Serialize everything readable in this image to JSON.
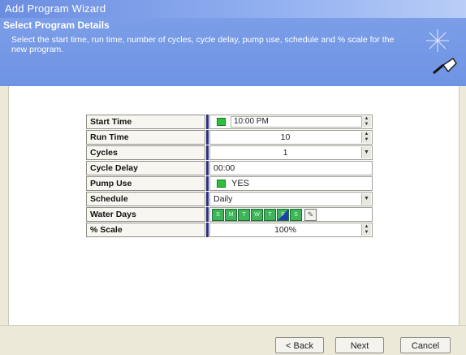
{
  "window": {
    "title": "Add Program Wizard"
  },
  "header": {
    "title": "Select Program Details",
    "description": "Select the start time, run time, number of cycles, cycle delay, pump use, schedule and % scale for the new program."
  },
  "fields": {
    "start_time": {
      "label": "Start Time",
      "value": "10:00 PM"
    },
    "run_time": {
      "label": "Run Time",
      "value": "10"
    },
    "cycles": {
      "label": "Cycles",
      "value": "1"
    },
    "cycle_delay": {
      "label": "Cycle Delay",
      "value": "00:00"
    },
    "pump_use": {
      "label": "Pump Use",
      "value": "YES"
    },
    "schedule": {
      "label": "Schedule",
      "value": "Daily"
    },
    "water_days": {
      "label": "Water Days",
      "days": [
        "S",
        "M",
        "T",
        "W",
        "T",
        "F",
        "S"
      ]
    },
    "scale": {
      "label": "% Scale",
      "value": "100%"
    }
  },
  "buttons": {
    "back": "< Back",
    "next": "Next",
    "cancel": "Cancel"
  },
  "colors": {
    "accent": "#6f93e4",
    "toggle_green": "#2fbf3c",
    "separator": "#2d2f7a"
  }
}
